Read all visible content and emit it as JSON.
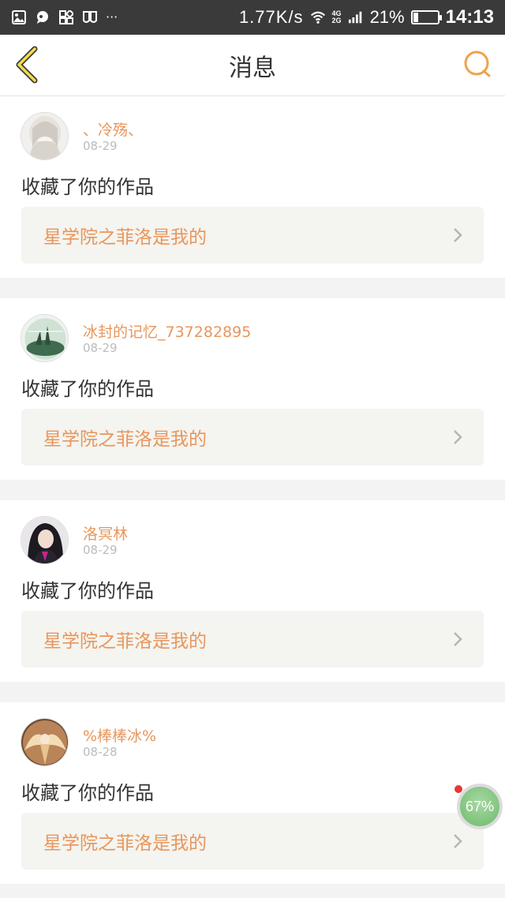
{
  "status_bar": {
    "network_speed": "1.77K/s",
    "net_type_top": "4G",
    "net_type_bottom": "2G",
    "battery_percent": "21%",
    "battery_level": 0.21,
    "time": "14:13"
  },
  "nav": {
    "title": "消息",
    "back_icon": "chevron-left-icon",
    "search_icon": "search-icon",
    "accent_color": "#f0a24a"
  },
  "messages": [
    {
      "username": "、冷殇、",
      "date": "08-29",
      "action": "收藏了你的作品",
      "work_title": "星学院之菲洛是我的"
    },
    {
      "username": "冰封的记忆_737282895",
      "date": "08-29",
      "action": "收藏了你的作品",
      "work_title": "星学院之菲洛是我的"
    },
    {
      "username": "洛冥林",
      "date": "08-29",
      "action": "收藏了你的作品",
      "work_title": "星学院之菲洛是我的"
    },
    {
      "username": "%棒棒冰%",
      "date": "08-28",
      "action": "收藏了你的作品",
      "work_title": "星学院之菲洛是我的"
    }
  ],
  "floating_badge": {
    "label": "67%"
  }
}
